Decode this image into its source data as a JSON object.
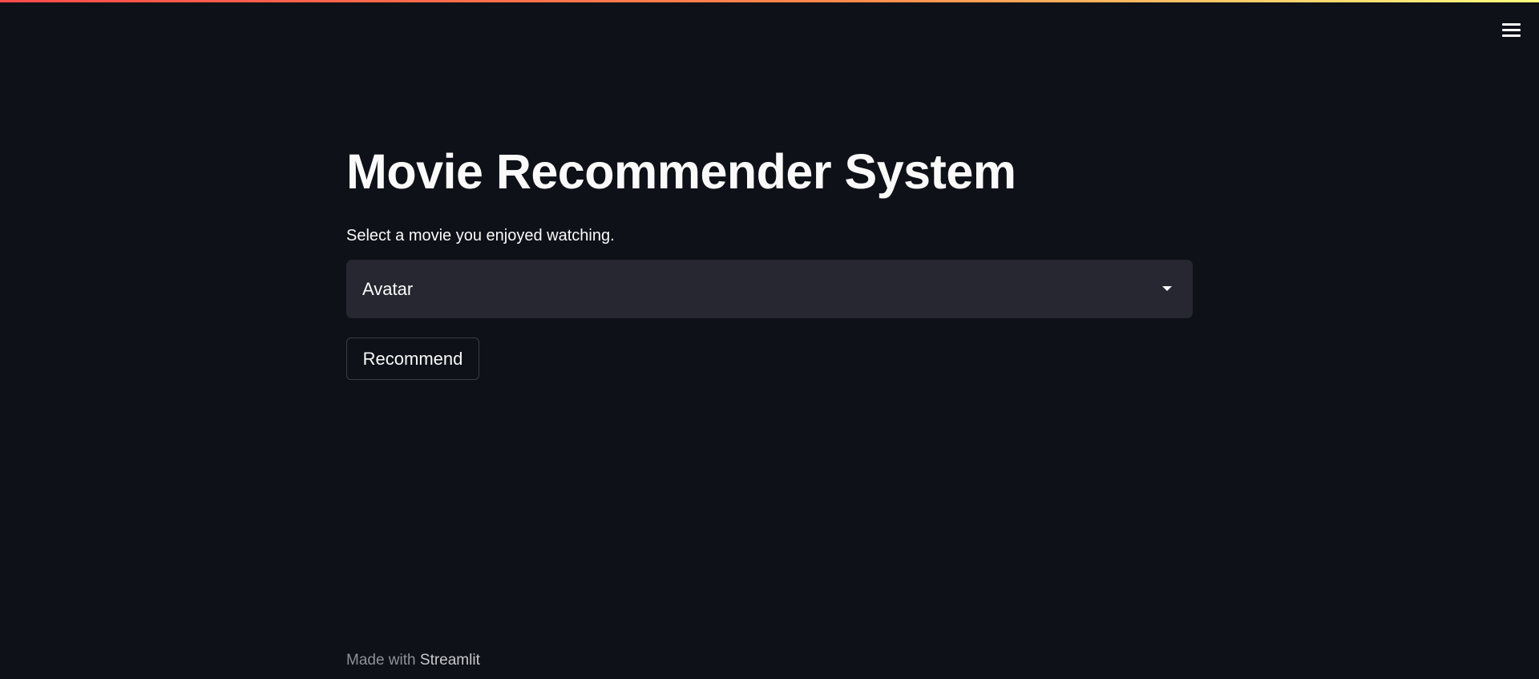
{
  "header": {
    "menu_icon": "hamburger-menu-icon",
    "accent_gradient": [
      "#ff4b4b",
      "#ff8a4b",
      "#fffd80"
    ]
  },
  "main": {
    "title": "Movie Recommender System",
    "select": {
      "label": "Select a movie you enjoyed watching.",
      "value": "Avatar",
      "icon": "chevron-down-icon"
    },
    "button": {
      "label": "Recommend"
    }
  },
  "footer": {
    "prefix": "Made with",
    "brand": "Streamlit"
  },
  "colors": {
    "background": "#0e1117",
    "select_background": "#262730",
    "text": "#fafafa"
  }
}
